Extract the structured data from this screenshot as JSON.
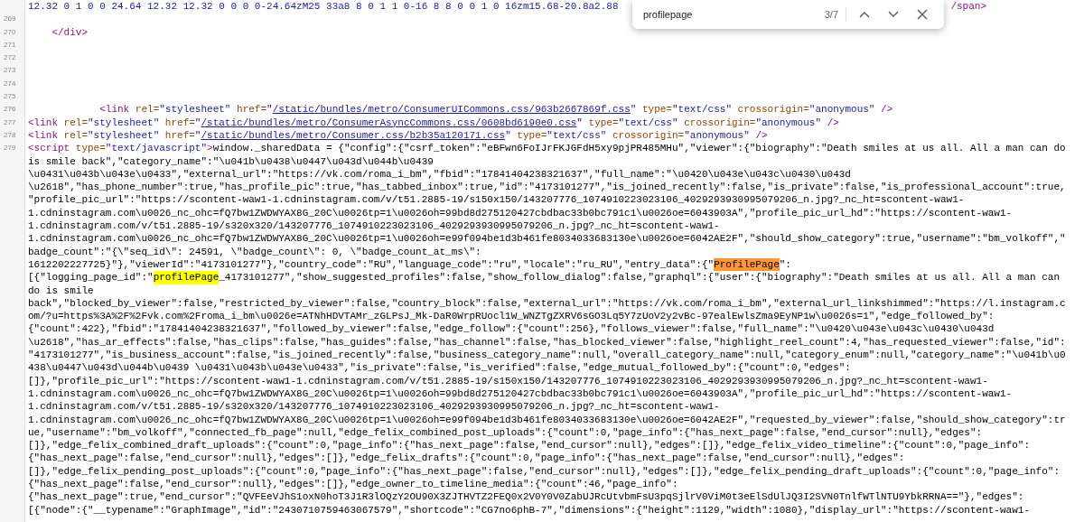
{
  "source_lines": [
    {
      "kind": "partly_hidden",
      "tokens": [
        {
          "kind": "value",
          "text": "12.32 0 1 0 0 24.64 12.32 12.32 0 0 0 0-24.64zM25 33a8 8 0 1 1 0-16 8 8 0 0 1 0 16zm15.68-20.8a2.88"
        },
        {
          "kind": "tag",
          "text": "/span>"
        }
      ]
    },
    {
      "number": "269"
    },
    {
      "number": "270",
      "tokens": [
        {
          "kind": "tag",
          "text": "    </div>"
        }
      ]
    },
    {
      "number": "271"
    },
    {
      "number": "272"
    },
    {
      "number": "273"
    },
    {
      "number": "274"
    },
    {
      "number": "275"
    },
    {
      "number": "276",
      "tokens": [
        {
          "kind": "tag",
          "text": "            <link "
        },
        {
          "kind": "attr",
          "text": "rel="
        },
        {
          "kind": "value",
          "text": "\"stylesheet\" "
        },
        {
          "kind": "attr",
          "text": "href="
        },
        {
          "kind": "value",
          "text": "\""
        },
        {
          "kind": "link",
          "text": "/static/bundles/metro/ConsumerUICommons.css/963b2667869f.css"
        },
        {
          "kind": "value",
          "text": "\" "
        },
        {
          "kind": "attr",
          "text": "type="
        },
        {
          "kind": "value",
          "text": "\"text/css\" "
        },
        {
          "kind": "attr",
          "text": "crossorigin="
        },
        {
          "kind": "value",
          "text": "\"anonymous\" "
        },
        {
          "kind": "tag",
          "text": "/>"
        }
      ]
    },
    {
      "number": "277",
      "tokens": [
        {
          "kind": "tag",
          "text": "<link "
        },
        {
          "kind": "attr",
          "text": "rel="
        },
        {
          "kind": "value",
          "text": "\"stylesheet\" "
        },
        {
          "kind": "attr",
          "text": "href="
        },
        {
          "kind": "value",
          "text": "\""
        },
        {
          "kind": "link",
          "text": "/static/bundles/metro/ConsumerAsyncCommons.css/0608bd6190e0.css"
        },
        {
          "kind": "value",
          "text": "\" "
        },
        {
          "kind": "attr",
          "text": "type="
        },
        {
          "kind": "value",
          "text": "\"text/css\" "
        },
        {
          "kind": "attr",
          "text": "crossorigin="
        },
        {
          "kind": "value",
          "text": "\"anonymous\" "
        },
        {
          "kind": "tag",
          "text": "/>"
        }
      ]
    },
    {
      "number": "278",
      "tokens": [
        {
          "kind": "tag",
          "text": "<link "
        },
        {
          "kind": "attr",
          "text": "rel="
        },
        {
          "kind": "value",
          "text": "\"stylesheet\" "
        },
        {
          "kind": "attr",
          "text": "href="
        },
        {
          "kind": "value",
          "text": "\""
        },
        {
          "kind": "link",
          "text": "/static/bundles/metro/Consumer.css/b2b35a120171.css"
        },
        {
          "kind": "value",
          "text": "\" "
        },
        {
          "kind": "attr",
          "text": "type="
        },
        {
          "kind": "value",
          "text": "\"text/css\" "
        },
        {
          "kind": "attr",
          "text": "crossorigin="
        },
        {
          "kind": "value",
          "text": "\"anonymous\" "
        },
        {
          "kind": "tag",
          "text": "/>"
        }
      ]
    },
    {
      "number": "279",
      "tokens": [
        {
          "kind": "tag",
          "text": "<script "
        },
        {
          "kind": "attr",
          "text": "type="
        },
        {
          "kind": "value",
          "text": "\"text/javascript\""
        },
        {
          "kind": "tag",
          "text": ">"
        },
        {
          "kind": "text",
          "text": "window._sharedData = {\"config\":{\"csrf_token\":\"eBFwn6FoIJrFKJGFdH5xy9pjPR485MHu\",\"viewer\":{\"biography\":\"Death smiles at us all. All a man can do"
        }
      ]
    },
    {
      "tokens": [
        {
          "kind": "text",
          "text": "is smile back\",\"category_name\":\"\\u041b\\u0438\\u0447\\u043d\\u044b\\u0439"
        }
      ]
    },
    {
      "tokens": [
        {
          "kind": "text",
          "text": "\\u0431\\u043b\\u043e\\u0433\",\"external_url\":\"https://vk.com/roma_i_bm\",\"fbid\":\"17841404238321637\",\"full_name\":\"\\u0420\\u043e\\u043c\\u0430\\u043d"
        }
      ]
    },
    {
      "tokens": [
        {
          "kind": "text",
          "text": "\\u2618\",\"has_phone_number\":true,\"has_profile_pic\":true,\"has_tabbed_inbox\":true,\"id\":\"4173101277\",\"is_joined_recently\":false,\"is_private\":false,\"is_professional_account\":true,"
        }
      ]
    },
    {
      "tokens": [
        {
          "kind": "text",
          "text": "\"profile_pic_url\":\"https://scontent-waw1-1.cdninstagram.com/v/t51.2885-19/s150x150/143207776_1074910223023106_4029293930995079206_n.jpg?_nc_ht=scontent-waw1-"
        }
      ]
    },
    {
      "tokens": [
        {
          "kind": "text",
          "text": "1.cdninstagram.com\\u0026_nc_ohc=fQ7bw1ZWDWYAX8G_20C\\u0026tp=1\\u0026oh=99bd8d275120427cbdbac33b0bc791c1\\u0026oe=6043903A\",\"profile_pic_url_hd\":\"https://scontent-waw1-"
        }
      ]
    },
    {
      "tokens": [
        {
          "kind": "text",
          "text": "1.cdninstagram.com/v/t51.2885-19/s320x320/143207776_1074910223023106_4029293930995079206_n.jpg?_nc_ht=scontent-waw1-"
        }
      ]
    },
    {
      "tokens": [
        {
          "kind": "text",
          "text": "1.cdninstagram.com\\u0026_nc_ohc=fQ7bw1ZWDWYAX8G_20C\\u0026tp=1\\u0026oh=e99f094be1d3b461fe8034033683130e\\u0026oe=6042AE2F\",\"should_show_category\":true,\"username\":\"bm_volkoff\",\""
        }
      ]
    },
    {
      "tokens": [
        {
          "kind": "text",
          "text": "badge_count\":\"{\\\"seq_id\\\": 24591, \\\"badge_count\\\": 0, \\\"badge_count_at_ms\\\":"
        }
      ]
    },
    {
      "tokens": [
        {
          "kind": "text",
          "text": "1612202227725}\"},\"viewerId\":\"4173101277\"},\"country_code\":\"RU\",\"language_code\":\"ru\",\"locale\":\"ru_RU\",\"entry_data\":{\""
        },
        {
          "kind": "match",
          "selected": true,
          "text": "ProfilePage"
        },
        {
          "kind": "text",
          "text": "\":"
        }
      ]
    },
    {
      "tokens": [
        {
          "kind": "text",
          "text": "[{\"logging_page_id\":\""
        },
        {
          "kind": "match",
          "selected": false,
          "text": "profilePage"
        },
        {
          "kind": "text",
          "text": "_4173101277\",\"show_suggested_profiles\":false,\"show_follow_dialog\":false,\"graphql\":{\"user\":{\"biography\":\"Death smiles at us all. All a man can"
        }
      ]
    },
    {
      "tokens": [
        {
          "kind": "text",
          "text": "do is smile"
        }
      ]
    },
    {
      "tokens": [
        {
          "kind": "text",
          "text": "back\",\"blocked_by_viewer\":false,\"restricted_by_viewer\":false,\"country_block\":false,\"external_url\":\"https://vk.com/roma_i_bm\",\"external_url_linkshimmed\":\"https://l.instagram.c"
        }
      ]
    },
    {
      "tokens": [
        {
          "kind": "text",
          "text": "om/?u=https%3A%2F%2Fvk.com%2Froma_i_bm\\u0026e=ATNhHDVTAMr_zGLPsJ_Mk-DaR0WrpRUocl1W_WNZTgZXRV6sGO3Lq5Y7zUoV2y2vBc-97ealEwlsZma9EyNP1w\\u0026s=1\",\"edge_followed_by\":"
        }
      ]
    },
    {
      "tokens": [
        {
          "kind": "text",
          "text": "{\"count\":422},\"fbid\":\"17841404238321637\",\"followed_by_viewer\":false,\"edge_follow\":{\"count\":256},\"follows_viewer\":false,\"full_name\":\"\\u0420\\u043e\\u043c\\u0430\\u043d"
        }
      ]
    },
    {
      "tokens": [
        {
          "kind": "text",
          "text": "\\u2618\",\"has_ar_effects\":false,\"has_clips\":false,\"has_guides\":false,\"has_channel\":false,\"has_blocked_viewer\":false,\"highlight_reel_count\":4,\"has_requested_viewer\":false,\"id\":"
        }
      ]
    },
    {
      "tokens": [
        {
          "kind": "text",
          "text": "\"4173101277\",\"is_business_account\":false,\"is_joined_recently\":false,\"business_category_name\":null,\"overall_category_name\":null,\"category_enum\":null,\"category_name\":\"\\u041b\\u0"
        }
      ]
    },
    {
      "tokens": [
        {
          "kind": "text",
          "text": "438\\u0447\\u043d\\u044b\\u0439 \\u0431\\u043b\\u043e\\u0433\",\"is_private\":false,\"is_verified\":false,\"edge_mutual_followed_by\":{\"count\":0,\"edges\":"
        }
      ]
    },
    {
      "tokens": [
        {
          "kind": "text",
          "text": "[]},\"profile_pic_url\":\"https://scontent-waw1-1.cdninstagram.com/v/t51.2885-19/s150x150/143207776_1074910223023106_4029293930995079206_n.jpg?_nc_ht=scontent-waw1-"
        }
      ]
    },
    {
      "tokens": [
        {
          "kind": "text",
          "text": "1.cdninstagram.com\\u0026_nc_ohc=fQ7bw1ZWDWYAX8G_20C\\u0026tp=1\\u0026oh=99bd8d275120427cbdbac33b0bc791c1\\u0026oe=6043903A\",\"profile_pic_url_hd\":\"https://scontent-waw1-"
        }
      ]
    },
    {
      "tokens": [
        {
          "kind": "text",
          "text": "1.cdninstagram.com/v/t51.2885-19/s320x320/143207776_1074910223023106_4029293930995079206_n.jpg?_nc_ht=scontent-waw1-"
        }
      ]
    },
    {
      "tokens": [
        {
          "kind": "text",
          "text": "1.cdninstagram.com\\u0026_nc_ohc=fQ7bw1ZWDWYAX8G_20C\\u0026tp=1\\u0026oh=e99f094be1d3b461fe8034033683130e\\u0026oe=6042AE2F\",\"requested_by_viewer\":false,\"should_show_category\":tr"
        }
      ]
    },
    {
      "tokens": [
        {
          "kind": "text",
          "text": "ue,\"username\":\"bm_volkoff\",\"connected_fb_page\":null,\"edge_felix_combined_post_uploads\":{\"count\":0,\"page_info\":{\"has_next_page\":false,\"end_cursor\":null},\"edges\":"
        }
      ]
    },
    {
      "tokens": [
        {
          "kind": "text",
          "text": "[]},\"edge_felix_combined_draft_uploads\":{\"count\":0,\"page_info\":{\"has_next_page\":false,\"end_cursor\":null},\"edges\":[]},\"edge_felix_video_timeline\":{\"count\":0,\"page_info\":"
        }
      ]
    },
    {
      "tokens": [
        {
          "kind": "text",
          "text": "{\"has_next_page\":false,\"end_cursor\":null},\"edges\":[]},\"edge_felix_drafts\":{\"count\":0,\"page_info\":{\"has_next_page\":false,\"end_cursor\":null},\"edges\":"
        }
      ]
    },
    {
      "tokens": [
        {
          "kind": "text",
          "text": "[]},\"edge_felix_pending_post_uploads\":{\"count\":0,\"page_info\":{\"has_next_page\":false,\"end_cursor\":null},\"edges\":[]},\"edge_felix_pending_draft_uploads\":{\"count\":0,\"page_info\":"
        }
      ]
    },
    {
      "tokens": [
        {
          "kind": "text",
          "text": "{\"has_next_page\":false,\"end_cursor\":null},\"edges\":[]},\"edge_owner_to_timeline_media\":{\"count\":46,\"page_info\":"
        }
      ]
    },
    {
      "tokens": [
        {
          "kind": "text",
          "text": "{\"has_next_page\":true,\"end_cursor\":\"QVFEeVJhS1oxN0hoT3J1R3lOQzY2OU90X3ZJTHVTZ2FEQ0x2V0Y0V0ZabUJRcUtvbmFsU3pqSjlrV0ViM0t3eElSdUlJQ3I2SVN0TnlfWTlNTU9YbkRRNA==\"},\"edges\":"
        }
      ]
    },
    {
      "tokens": [
        {
          "kind": "text",
          "text": "[{\"node\":{\"__typename\":\"GraphImage\",\"id\":\"2430710759463067579\",\"shortcode\":\"CG7no6phB-7\",\"dimensions\":{\"height\":1129,\"width\":1080},\"display_url\":\"https://scontent-waw1-"
        }
      ]
    }
  ],
  "find_bar": {
    "query": "profilepage",
    "count": "3/7"
  }
}
